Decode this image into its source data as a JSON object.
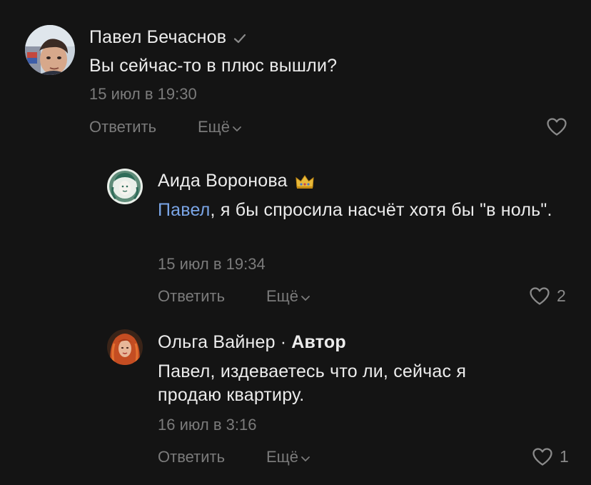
{
  "comments": [
    {
      "author": "Павел Бечаснов",
      "text": "Вы сейчас-то в плюс вышли?",
      "date": "15 июл в 19:30",
      "reply_label": "Ответить",
      "more_label": "Ещё",
      "likes": ""
    },
    {
      "author": "Аида Воронова",
      "mention": "Павел",
      "text": ", я бы спросила насчёт хотя бы \"в ноль\".",
      "date": "15 июл в 19:34",
      "reply_label": "Ответить",
      "more_label": "Ещё",
      "likes": "2"
    },
    {
      "author": "Ольга Вайнер",
      "separator": "·",
      "author_badge": "Автор",
      "text": "Павел, издеваетесь что ли, сейчас я продаю квартиру.",
      "date": "16 июл в 3:16",
      "reply_label": "Ответить",
      "more_label": "Ещё",
      "likes": "1"
    }
  ],
  "colors": {
    "background": "#141414",
    "text": "#ececec",
    "muted": "#7b7b7b",
    "mention": "#7aa5e6"
  }
}
